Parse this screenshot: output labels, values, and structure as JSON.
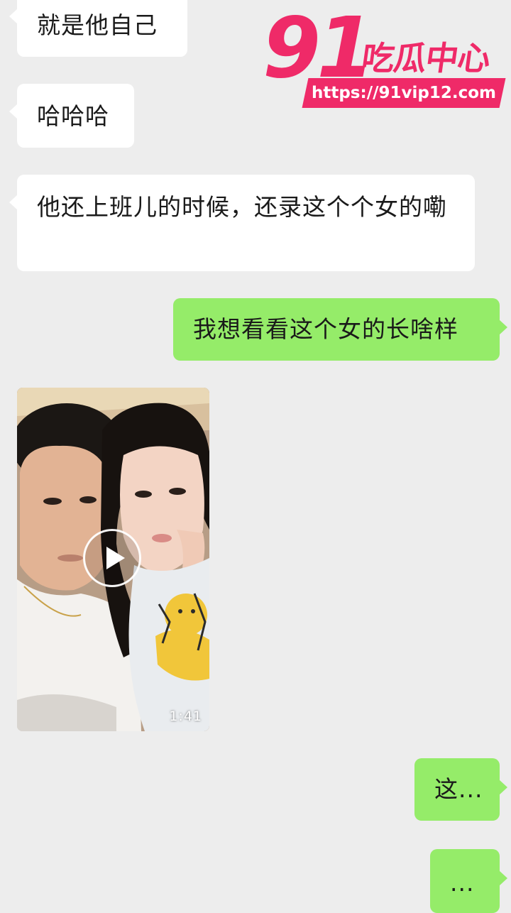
{
  "messages": [
    {
      "side": "in",
      "text": "就是他自己"
    },
    {
      "side": "in",
      "text": "哈哈哈"
    },
    {
      "side": "in",
      "text": "他还上班儿的时候，还录这个个女的嘞"
    },
    {
      "side": "out",
      "text": "我想看看这个女的长啥样"
    },
    {
      "side": "in",
      "type": "video",
      "duration": "1:41",
      "icon": "play-icon"
    },
    {
      "side": "out",
      "text": "这..."
    },
    {
      "side": "out",
      "text": "..."
    }
  ],
  "watermark": {
    "number": "91",
    "name": "吃瓜中心",
    "url": "https://91vip12.com"
  },
  "colors": {
    "background": "#ededed",
    "incoming_bubble": "#ffffff",
    "outgoing_bubble": "#95ec69",
    "watermark": "#ef2a68"
  }
}
